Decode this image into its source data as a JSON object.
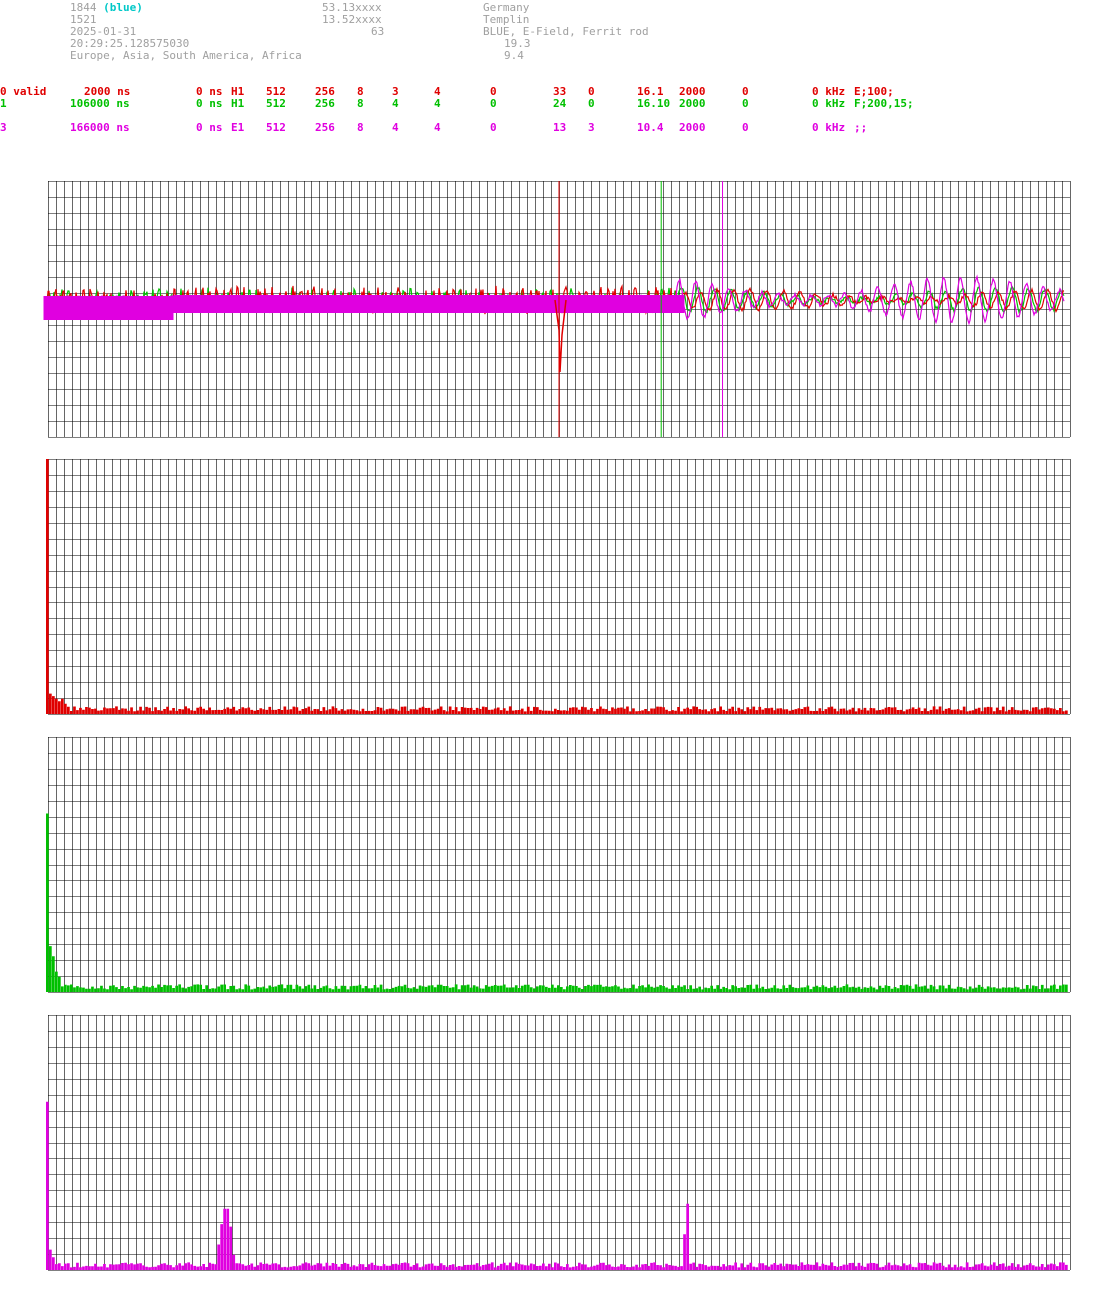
{
  "info": {
    "station_id": "1844",
    "station_tag": "(blue)",
    "line2": "1521",
    "date": "2025-01-31",
    "time": "20:29:25.128575030",
    "regions": "Europe, Asia, South America, Africa",
    "lat": "53.13xxxx",
    "lon": "13.52xxxx",
    "alt": "63",
    "country": "Germany",
    "city": "Templin",
    "antenna": "BLUE, E-Field, Ferrit rod",
    "val1": "19.3",
    "val2": "9.4"
  },
  "channels": [
    {
      "color": "#e00000",
      "c0": "0 valid",
      "c1": "2000 ns",
      "c2": "0 ns",
      "c3": "H1",
      "c4": "512",
      "c5": "256",
      "c6": "8",
      "c7": "3",
      "c8": "4",
      "c9": "0",
      "c10": "33",
      "c11": "0",
      "c12": "16.1",
      "c13": "2000",
      "c14": "0",
      "c15": "0 kHz",
      "c16": "E;100;"
    },
    {
      "color": "#00c000",
      "c0": "1",
      "c1": "106000 ns",
      "c2": "0 ns",
      "c3": "H1",
      "c4": "512",
      "c5": "256",
      "c6": "8",
      "c7": "4",
      "c8": "4",
      "c9": "0",
      "c10": "24",
      "c11": "0",
      "c12": "16.10",
      "c13": "2000",
      "c14": "0",
      "c15": "0 kHz",
      "c16": "F;200,15;"
    },
    {
      "color": "#e000e0",
      "c0": "3",
      "c1": "166000 ns",
      "c2": "0 ns",
      "c3": "E1",
      "c4": "512",
      "c5": "256",
      "c6": "8",
      "c7": "4",
      "c8": "4",
      "c9": "0",
      "c10": "13",
      "c11": "3",
      "c12": "10.4",
      "c13": "2000",
      "c14": "0",
      "c15": "0 kHz",
      "c16": ";;"
    }
  ],
  "colors": {
    "grid": "#000000",
    "red": "#e00000",
    "green": "#00c000",
    "magenta": "#e000e0"
  },
  "markers": [
    {
      "color": "#e00000",
      "pos": 0.5
    },
    {
      "color": "#00c000",
      "pos": 0.6
    },
    {
      "color": "#e000e0",
      "pos": 0.66
    }
  ],
  "spectra": [
    {
      "color": "#e00000",
      "peaks": [
        [
          0,
          1.0
        ],
        [
          1,
          0.08
        ],
        [
          2,
          0.07
        ],
        [
          3,
          0.06
        ],
        [
          4,
          0.05
        ],
        [
          5,
          0.06
        ],
        [
          6,
          0.04
        ]
      ]
    },
    {
      "color": "#00c000",
      "peaks": [
        [
          0,
          0.7
        ],
        [
          1,
          0.18
        ],
        [
          2,
          0.14
        ],
        [
          3,
          0.08
        ],
        [
          4,
          0.06
        ]
      ]
    },
    {
      "color": "#e000e0",
      "peaks": [
        [
          0,
          0.66
        ],
        [
          1,
          0.08
        ],
        [
          2,
          0.05
        ],
        [
          57,
          0.1
        ],
        [
          58,
          0.18
        ],
        [
          59,
          0.24
        ],
        [
          60,
          0.24
        ],
        [
          61,
          0.17
        ],
        [
          62,
          0.06
        ],
        [
          212,
          0.14
        ],
        [
          213,
          0.26
        ]
      ]
    }
  ]
}
